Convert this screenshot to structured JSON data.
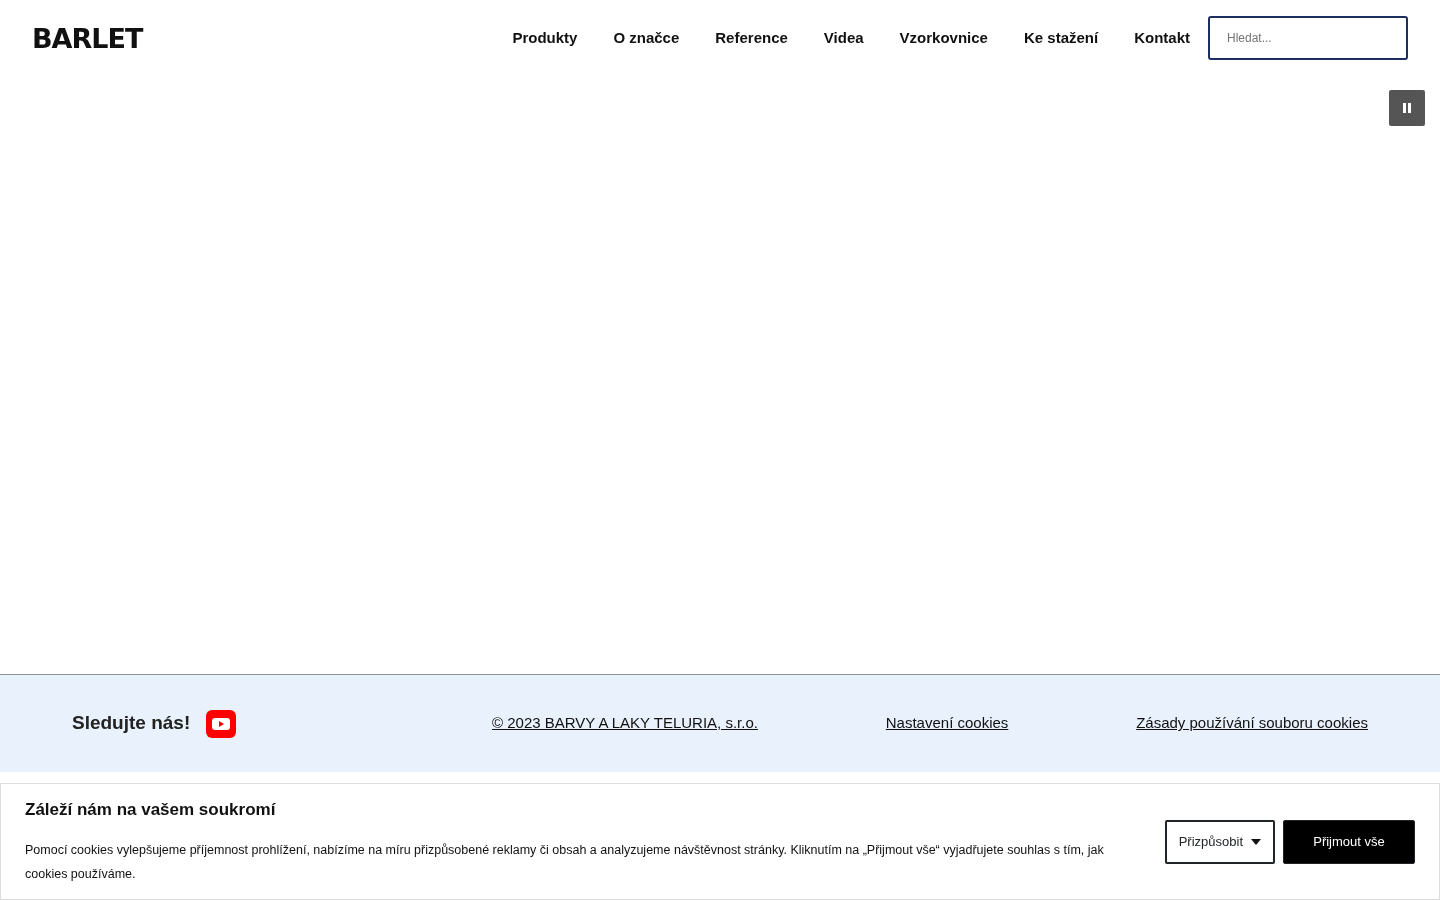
{
  "header": {
    "logo": "BARLET",
    "nav": [
      "Produkty",
      "O značce",
      "Reference",
      "Videa",
      "Vzorkovnice",
      "Ke stažení",
      "Kontakt"
    ],
    "search": {
      "placeholder": "Hledat..."
    }
  },
  "hero": {
    "pause_button": true
  },
  "footer": {
    "follow": "Sledujte nás!",
    "links": [
      "© 2023 BARVY A LAKY TELURIA, s.r.o.",
      "Nastavení cookies",
      "Zásady používání souboru cookies"
    ]
  },
  "cookie_banner": {
    "title": "Záleží nám na vašem soukromí",
    "text": "Pomocí cookies vylepšujeme příjemnost prohlížení, nabízíme na míru přizpůsobené reklamy či obsah a analyzujeme návštěvnost stránky. Kliknutím na „Přijmout vše“ vyjadřujete souhlas s tím, jak cookies používáme.",
    "buttons": [
      {
        "label": "Přizpůsobit",
        "kind": "dropdown"
      },
      {
        "label": "Přijmout vše",
        "kind": "primary"
      }
    ]
  }
}
